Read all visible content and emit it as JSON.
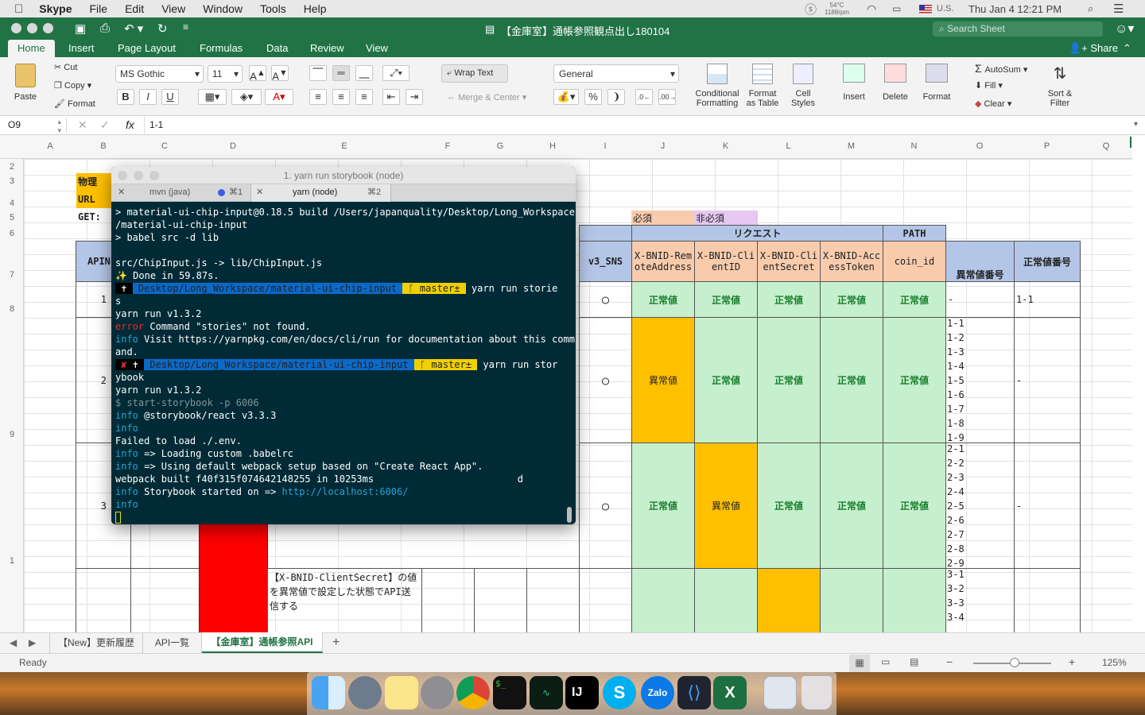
{
  "menubar": {
    "app": "Skype",
    "items": [
      "File",
      "Edit",
      "View",
      "Window",
      "Tools",
      "Help"
    ],
    "temp": "54°C",
    "rpm": "1188rpm",
    "input_source": "U.S.",
    "clock": "Thu Jan 4  12:21 PM"
  },
  "window": {
    "title": "【金庫室】通帳参照観点出し180104",
    "search_placeholder": "Search Sheet"
  },
  "ribbon_tabs": [
    "Home",
    "Insert",
    "Page Layout",
    "Formulas",
    "Data",
    "Review",
    "View"
  ],
  "share_label": "Share",
  "ribbon": {
    "paste": "Paste",
    "cut": "Cut",
    "copy": "Copy",
    "format": "Format",
    "font": "MS Gothic",
    "size": "11",
    "wrap": "Wrap Text",
    "merge": "Merge & Center",
    "numfmt": "General",
    "cond": "Conditional Formatting",
    "fmt_table": "Format as Table",
    "cell_styles": "Cell Styles",
    "insert": "Insert",
    "delete": "Delete",
    "format2": "Format",
    "autosum": "AutoSum",
    "fill": "Fill",
    "clear": "Clear",
    "sort": "Sort & Filter"
  },
  "formula_bar": {
    "cell_ref": "O9",
    "value": "1-1"
  },
  "columns": [
    "A",
    "B",
    "C",
    "D",
    "E",
    "F",
    "G",
    "H",
    "I",
    "J",
    "K",
    "L",
    "M",
    "N",
    "O",
    "P",
    "Q"
  ],
  "rows": [
    "2",
    "3",
    "4",
    "5",
    "6",
    "7",
    "8",
    "9",
    "1"
  ],
  "sheet": {
    "left_labels": [
      "物理URL",
      "GET:"
    ],
    "apin": "APIN",
    "must": "必須",
    "not_must": "非必須",
    "request": "リクエスト",
    "path": "PATH",
    "v3": "v3_SNS",
    "headers": [
      "X-BNID-RemoteAddress",
      "X-BNID-ClientID",
      "X-BNID-ClientSecret",
      "X-BNID-AccessToken",
      "coin_id"
    ],
    "abnormal_no": "異常値番号",
    "normal_no": "正常値番号",
    "row_nums": [
      "1",
      "2",
      "3"
    ],
    "circle": "○",
    "normal": "正常値",
    "abnormal": "異常値",
    "dash": "-",
    "r1_normal": "1-1",
    "list2": [
      "1-1",
      "1-2",
      "1-3",
      "1-4",
      "1-5",
      "1-6",
      "1-7",
      "1-8",
      "1-9"
    ],
    "list3": [
      "2-1",
      "2-2",
      "2-3",
      "2-4",
      "2-5",
      "2-6",
      "2-7",
      "2-8",
      "2-9"
    ],
    "list4": [
      "3-1",
      "3-2",
      "3-3",
      "3-4"
    ],
    "note": "【X-BNID-ClientSecret】の値を異常値で設定した状態でAPI送信する"
  },
  "terminal": {
    "title": "1. yarn run storybook (node)",
    "tab1": "mvn (java)",
    "tab1_key": "⌘1",
    "tab2": "yarn (node)",
    "tab2_key": "⌘2",
    "lines": {
      "l1": "> material-ui-chip-input@0.18.5 build /Users/japanquality/Desktop/Long_Workspace",
      "l2": "/material-ui-chip-input",
      "l3": "> babel src -d lib",
      "l5": "src/ChipInput.js -> lib/ChipInput.js",
      "l6": "✨ Done in 59.87s.",
      "path1": " Desktop/Long_Workspace/material-ui-chip-input ",
      "branch": " ᚴ master± ",
      "cmd1": " yarn run storie",
      "l8": "s",
      "l9": "yarn run v1.3.2",
      "err_tag": "error",
      "err_msg": " Command \"stories\" not found.",
      "info": "info",
      "visit": " Visit https://yarnpkg.com/en/docs/cli/run for documentation about this comm",
      "and": "and.",
      "cmd2": " yarn run stor",
      "ybook": "ybook",
      "l15": "yarn run v1.3.2",
      "l16": "$ start-storybook -p 6006",
      "sb": " @storybook/react v3.3.3",
      "failed": "Failed to load ./.env.",
      "loading": " => Loading custom .babelrc",
      "using": " => Using default webpack setup based on \"Create React App\".",
      "webpack": "webpack built f40f315f074642148255 in 10253ms                         d",
      "started": " Storybook started on => ",
      "url": "http://localhost:6006/"
    }
  },
  "sheet_tabs": [
    "【New】更新履歴",
    "API一覧",
    "【金庫室】通帳参照API"
  ],
  "status": {
    "ready": "Ready",
    "zoom": "125%"
  }
}
